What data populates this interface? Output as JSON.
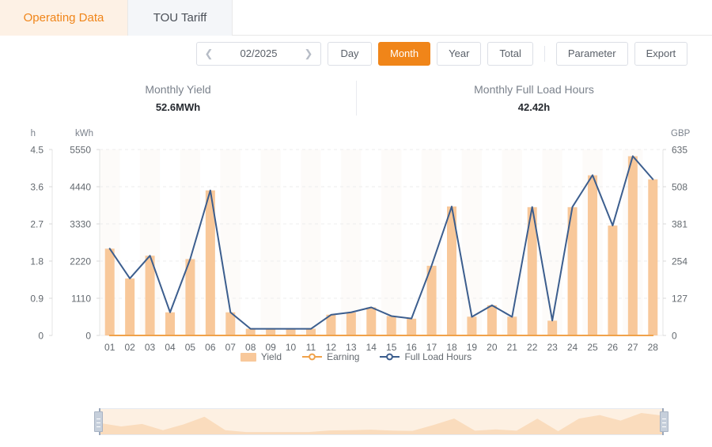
{
  "tabs": [
    {
      "label": "Operating Data",
      "active": true
    },
    {
      "label": "TOU Tariff",
      "active": false
    }
  ],
  "toolbar": {
    "prev_icon": "chevron-left-icon",
    "next_icon": "chevron-right-icon",
    "date_value": "02/2025",
    "day_label": "Day",
    "month_label": "Month",
    "year_label": "Year",
    "total_label": "Total",
    "parameter_label": "Parameter",
    "export_label": "Export",
    "selected_range": "Month",
    "accent_color": "#f08519"
  },
  "summary": {
    "yield": {
      "label": "Monthly Yield",
      "value": "52.6MWh"
    },
    "full_load_hours": {
      "label": "Monthly Full Load Hours",
      "value": "42.42h"
    }
  },
  "legend": [
    {
      "label": "Yield",
      "color": "#f8c89a",
      "marker": "bar"
    },
    {
      "label": "Earning",
      "color": "#f0a24a",
      "marker": "line-circle"
    },
    {
      "label": "Full Load Hours",
      "color": "#3c5e8e",
      "marker": "line-circle"
    }
  ],
  "chart_data": {
    "type": "bar",
    "title": "",
    "xlabel": "",
    "grid": true,
    "legend_position": "bottom",
    "categories": [
      "01",
      "02",
      "03",
      "04",
      "05",
      "06",
      "07",
      "08",
      "09",
      "10",
      "11",
      "12",
      "13",
      "14",
      "15",
      "16",
      "17",
      "18",
      "19",
      "20",
      "21",
      "22",
      "23",
      "24",
      "25",
      "26",
      "27",
      "28"
    ],
    "axes": {
      "left_outer": {
        "name": "h",
        "unit": "h",
        "ticks": [
          "0",
          "0.9",
          "1.8",
          "2.7",
          "3.6",
          "4.5"
        ],
        "min": 0,
        "max": 4.5
      },
      "left_inner": {
        "name": "kWh",
        "unit": "kWh",
        "ticks": [
          "0",
          "1110",
          "2220",
          "3330",
          "4440",
          "5550"
        ],
        "min": 0,
        "max": 5550
      },
      "right": {
        "name": "GBP",
        "unit": "GBP",
        "ticks": [
          "0",
          "127",
          "254",
          "381",
          "508",
          "635"
        ],
        "min": 0,
        "max": 635
      }
    },
    "series": [
      {
        "name": "Yield",
        "unit": "kWh",
        "axis": "left_inner",
        "type": "bar",
        "color": "#f8c89a",
        "values": [
          2590,
          1700,
          2380,
          690,
          2280,
          4330,
          690,
          200,
          200,
          200,
          200,
          620,
          690,
          840,
          580,
          500,
          2080,
          3850,
          560,
          900,
          560,
          3830,
          440,
          3830,
          4780,
          3280,
          5350,
          4660
        ]
      },
      {
        "name": "Earning",
        "unit": "GBP",
        "axis": "right",
        "type": "line",
        "color": "#f0a24a",
        "values": [
          0,
          0,
          0,
          0,
          0,
          0,
          0,
          0,
          0,
          0,
          0,
          0,
          0,
          0,
          0,
          0,
          0,
          0,
          0,
          0,
          0,
          0,
          0,
          0,
          0,
          0,
          0,
          0
        ]
      },
      {
        "name": "Full Load Hours",
        "unit": "h",
        "axis": "left_outer",
        "type": "line",
        "color": "#3c5e8e",
        "values": [
          2.1,
          1.38,
          1.93,
          0.56,
          1.85,
          3.51,
          0.56,
          0.16,
          0.16,
          0.16,
          0.16,
          0.5,
          0.56,
          0.68,
          0.47,
          0.41,
          1.69,
          3.12,
          0.45,
          0.73,
          0.45,
          3.11,
          0.36,
          3.11,
          3.88,
          2.66,
          4.34,
          3.78
        ]
      }
    ],
    "datazoom": {
      "start_percent": 0,
      "end_percent": 100,
      "preview_values": [
        2590,
        1700,
        2380,
        690,
        2280,
        4330,
        690,
        200,
        200,
        200,
        200,
        620,
        690,
        840,
        580,
        500,
        2080,
        3850,
        560,
        900,
        560,
        3830,
        440,
        3830,
        4780,
        3280,
        5350,
        4660
      ]
    }
  }
}
